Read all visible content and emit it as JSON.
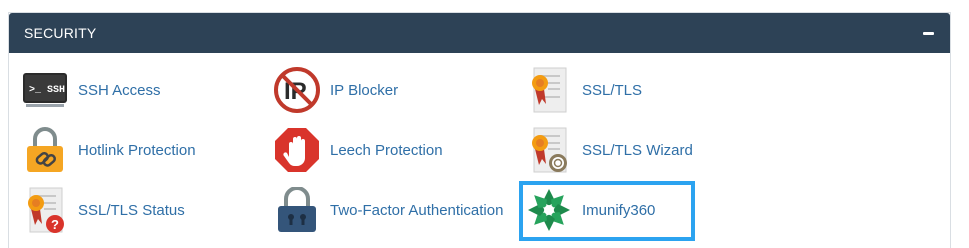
{
  "panel": {
    "title": "SECURITY",
    "collapse_icon": "minus-icon"
  },
  "items": [
    {
      "label": "SSH Access",
      "icon": "ssh-terminal-icon"
    },
    {
      "label": "IP Blocker",
      "icon": "ip-blocker-icon"
    },
    {
      "label": "SSL/TLS",
      "icon": "ssl-certificate-icon"
    },
    {
      "label": "Hotlink Protection",
      "icon": "padlock-chain-icon"
    },
    {
      "label": "Leech Protection",
      "icon": "stop-hand-icon"
    },
    {
      "label": "SSL/TLS Wizard",
      "icon": "ssl-wizard-icon"
    },
    {
      "label": "SSL/TLS Status",
      "icon": "ssl-status-icon"
    },
    {
      "label": "Two-Factor Authentication",
      "icon": "padlock-icon"
    },
    {
      "label": "Imunify360",
      "icon": "imunify360-logo-icon"
    }
  ],
  "colors": {
    "header_bg": "#2d4256",
    "link_text": "#2f6fa7",
    "highlight_border": "#2ba3f0"
  }
}
